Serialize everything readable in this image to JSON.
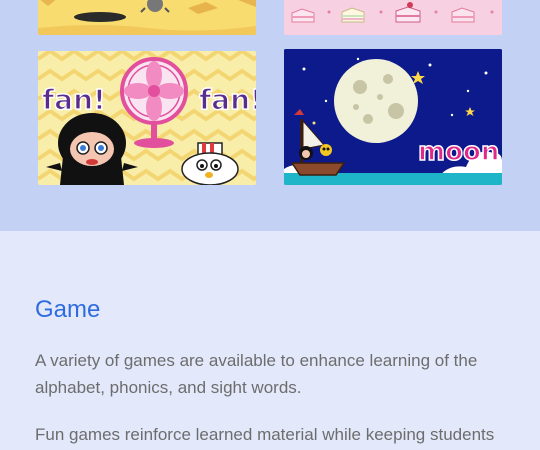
{
  "thumbnails": {
    "fan": {
      "word_left": "fan!",
      "word_right": "fan!"
    },
    "moon": {
      "word": "moon"
    }
  },
  "section": {
    "title": "Game",
    "paragraphs": [
      "A variety of games are available to enhance learning of the alphabet, phonics, and sight words.",
      "Fun games reinforce learned material while keeping students"
    ]
  }
}
